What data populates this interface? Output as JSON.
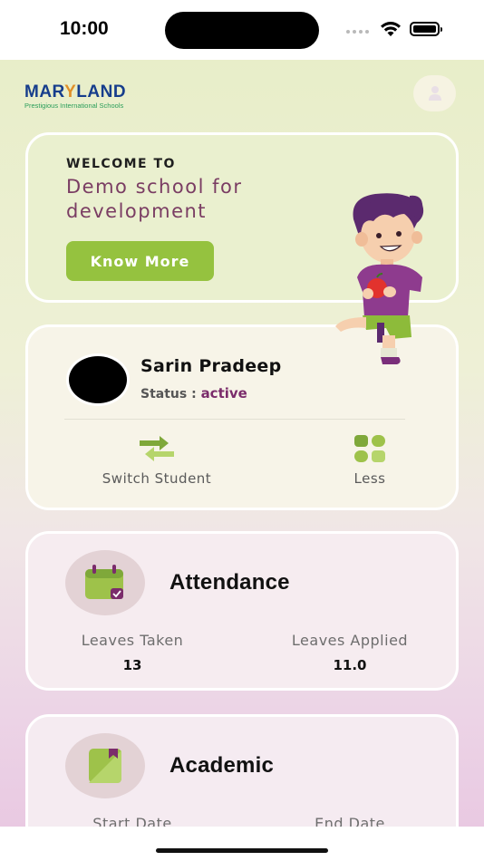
{
  "status_bar": {
    "time": "10:00"
  },
  "header": {
    "logo_main_left": "MAR",
    "logo_main_y": "Y",
    "logo_main_right": "LAND",
    "logo_tagline": "Prestigious International Schools"
  },
  "welcome": {
    "label": "WELCOME TO",
    "school_name": "Demo school for development",
    "button_label": "Know More"
  },
  "student": {
    "name": "Sarin Pradeep",
    "status_label": "Status :",
    "status_value": "active",
    "switch_label": "Switch Student",
    "less_label": "Less"
  },
  "attendance": {
    "title": "Attendance",
    "leaves_taken_label": "Leaves Taken",
    "leaves_taken_value": "13",
    "leaves_applied_label": "Leaves Applied",
    "leaves_applied_value": "11.0"
  },
  "academic": {
    "title": "Academic",
    "start_label": "Start Date",
    "end_label": "End Date"
  },
  "colors": {
    "accent_green": "#95c23f",
    "status_purple": "#7b2c6b",
    "school_name": "#7a3d63"
  }
}
